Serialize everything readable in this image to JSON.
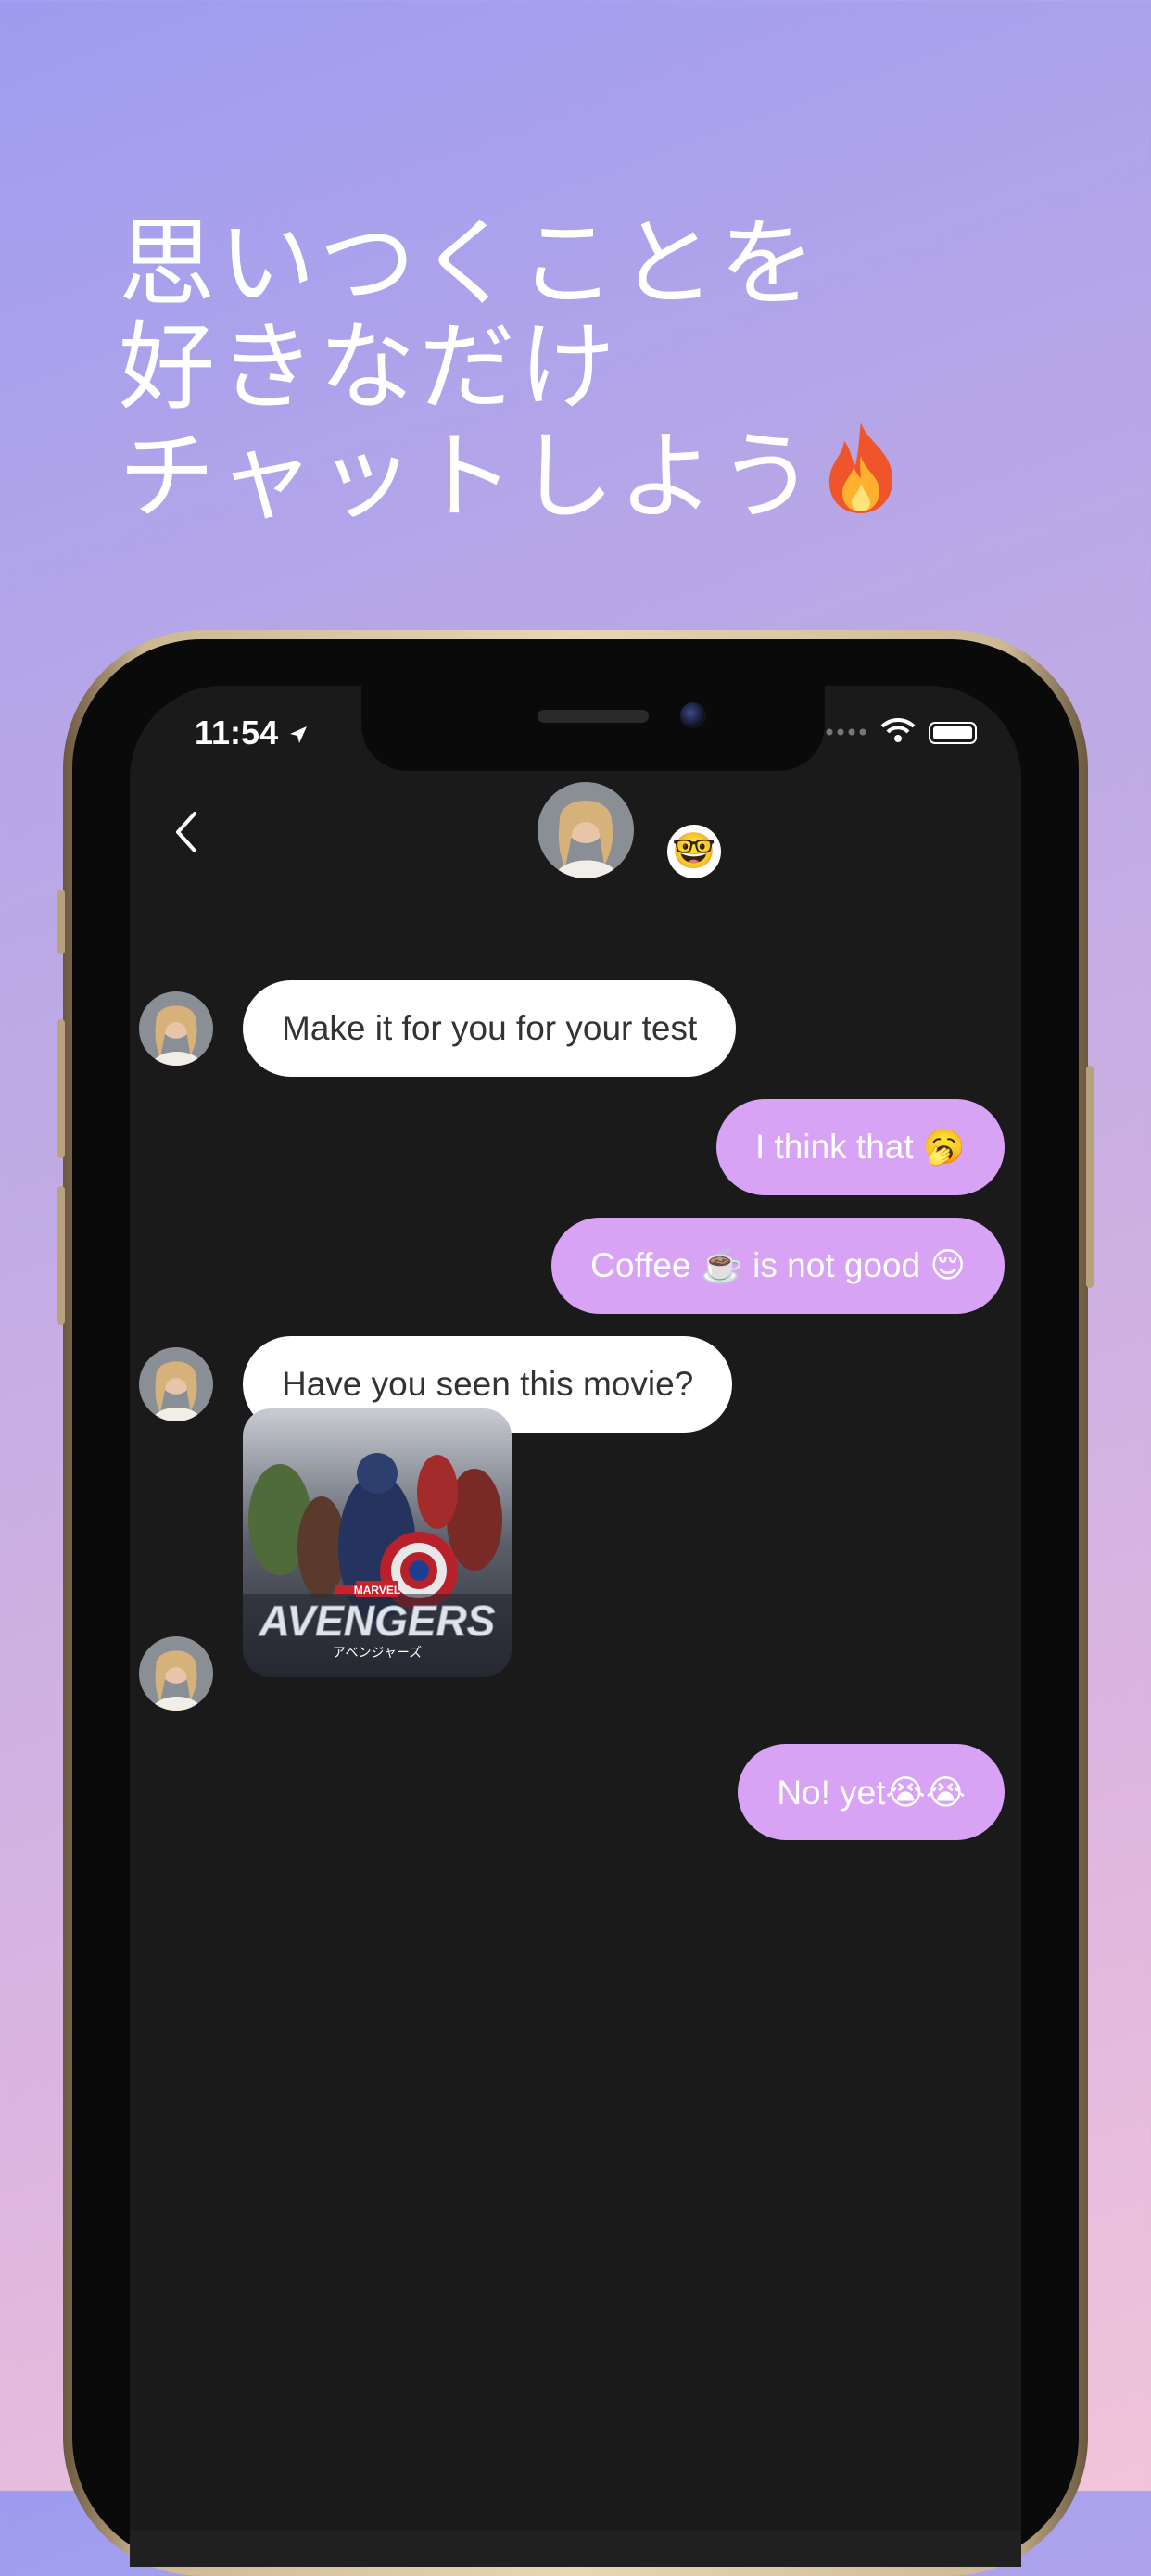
{
  "headline": {
    "line1": "思いつくことを",
    "line2": "好きなだけ",
    "line3": "チャットしよう",
    "icon": "flame-icon"
  },
  "status_bar": {
    "time": "11:54"
  },
  "chat_header": {
    "partner_emoji": "🤓",
    "back_icon": "chevron-left-icon"
  },
  "messages": [
    {
      "id": "m1",
      "direction": "incoming",
      "text": "Make it for you for your test"
    },
    {
      "id": "m2",
      "direction": "outgoing",
      "text": "I think that 🥱"
    },
    {
      "id": "m3",
      "direction": "outgoing",
      "text": "Coffee ☕️ is not good 😌"
    },
    {
      "id": "m4",
      "direction": "incoming",
      "text": "Have you seen this movie?"
    },
    {
      "id": "m5",
      "direction": "incoming",
      "type": "image",
      "image_text": {
        "brand": "MARVEL",
        "title": "AVENGERS",
        "subtitle": "アベンジャーズ"
      }
    },
    {
      "id": "m6",
      "direction": "outgoing",
      "text": "No! yet😭😭"
    }
  ],
  "colors": {
    "outgoing_bubble": "#d9a3f5",
    "incoming_bubble": "#ffffff",
    "chat_background": "#1a1a1a"
  }
}
